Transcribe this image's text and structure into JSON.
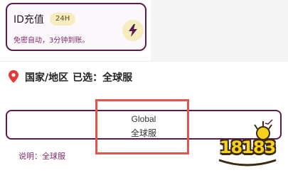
{
  "topup": {
    "title": "ID充值",
    "badge": "24H",
    "subtitle": "免密自动，3分钟到账。",
    "icon": "lightning-bolt-icon"
  },
  "region": {
    "label": "国家/地区",
    "selected_prefix": "已选：",
    "selected_value": "全球服",
    "option": {
      "name_en": "Global",
      "name_zh": "全球服"
    },
    "note": "说明：全球服"
  },
  "watermark": {
    "text": "18183"
  },
  "colors": {
    "accent": "#5a1c4d",
    "highlight": "#e0564f",
    "badge_bg": "#f7ecc0",
    "pin": "#e53935"
  }
}
